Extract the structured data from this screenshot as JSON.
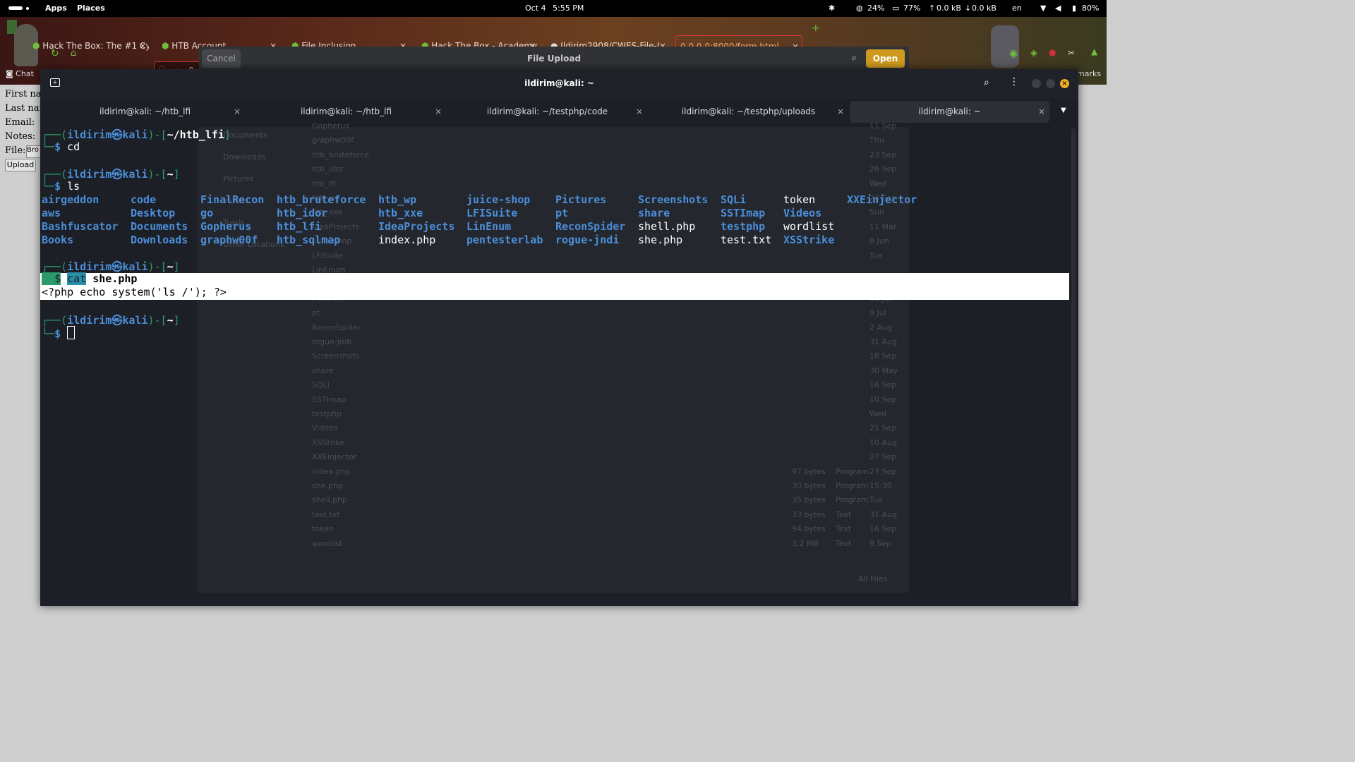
{
  "topbar": {
    "apps": "Apps",
    "places": "Places",
    "date": "Oct 4",
    "time": "5:55 PM",
    "cpu": "24%",
    "mem": "77%",
    "up": "0.0 kB",
    "down": "0.0 kB",
    "lang": "en",
    "battery": "80%"
  },
  "browser": {
    "tabs": [
      {
        "label": "Hack The Box: The #1 Cyb"
      },
      {
        "label": "HTB Account"
      },
      {
        "label": "File Inclusion"
      },
      {
        "label": "Hack The Box - Academy"
      },
      {
        "label": "Ildirim2908/CWES-File-I"
      },
      {
        "label": "0.0.0.0:8000/form.html"
      }
    ],
    "url_fragment": "0.",
    "bookmarks_label": "marks",
    "chat_label": "Chat"
  },
  "dialog": {
    "cancel": "Cancel",
    "title": "File Upload",
    "open": "Open",
    "sidebar": [
      "Documents",
      "Downloads",
      "Pictures",
      "Videos",
      "Trash",
      "Other Locations"
    ],
    "files": [
      {
        "name": "Gopherus",
        "size": "",
        "kind": "",
        "date": "11 Sep"
      },
      {
        "name": "graphw00f",
        "size": "",
        "kind": "",
        "date": "Thu"
      },
      {
        "name": "htb_bruteforce",
        "size": "",
        "kind": "",
        "date": "23 Sep"
      },
      {
        "name": "htb_idor",
        "size": "",
        "kind": "",
        "date": "26 Sep"
      },
      {
        "name": "htb_lfi",
        "size": "",
        "kind": "",
        "date": "Wed"
      },
      {
        "name": "htb_wp",
        "size": "",
        "kind": "",
        "date": "23 Sep"
      },
      {
        "name": "htb_xxe",
        "size": "",
        "kind": "",
        "date": "Sun"
      },
      {
        "name": "IdeaProjects",
        "size": "",
        "kind": "",
        "date": "11 Mar"
      },
      {
        "name": "juice-shop",
        "size": "",
        "kind": "",
        "date": "8 Jun"
      },
      {
        "name": "LFISuite",
        "size": "",
        "kind": "",
        "date": "Tue"
      },
      {
        "name": "LinEnum",
        "size": "",
        "kind": "",
        "date": ""
      },
      {
        "name": "pentesterlab",
        "size": "",
        "kind": "",
        "date": ""
      },
      {
        "name": "Pictures",
        "size": "",
        "kind": "",
        "date": "18 Jul"
      },
      {
        "name": "pt",
        "size": "",
        "kind": "",
        "date": "9 Jul"
      },
      {
        "name": "ReconSpider",
        "size": "",
        "kind": "",
        "date": "2 Aug"
      },
      {
        "name": "rogue-jndi",
        "size": "",
        "kind": "",
        "date": "31 Aug"
      },
      {
        "name": "Screenshots",
        "size": "",
        "kind": "",
        "date": "18 Sep"
      },
      {
        "name": "share",
        "size": "",
        "kind": "",
        "date": "30 May"
      },
      {
        "name": "SQLi",
        "size": "",
        "kind": "",
        "date": "16 Sep"
      },
      {
        "name": "SSTImap",
        "size": "",
        "kind": "",
        "date": "10 Sep"
      },
      {
        "name": "testphp",
        "size": "",
        "kind": "",
        "date": "Wed"
      },
      {
        "name": "Videos",
        "size": "",
        "kind": "",
        "date": "21 Sep"
      },
      {
        "name": "XSStrike",
        "size": "",
        "kind": "",
        "date": "10 Aug"
      },
      {
        "name": "XXEinjector",
        "size": "",
        "kind": "",
        "date": "27 Sep"
      },
      {
        "name": "index.php",
        "size": "97 bytes",
        "kind": "Program",
        "date": "27 Sep"
      },
      {
        "name": "she.php",
        "size": "30 bytes",
        "kind": "Program",
        "date": "15:30"
      },
      {
        "name": "shell.php",
        "size": "35 bytes",
        "kind": "Program",
        "date": "Tue"
      },
      {
        "name": "test.txt",
        "size": "33 bytes",
        "kind": "Text",
        "date": "31 Aug"
      },
      {
        "name": "token",
        "size": "94 bytes",
        "kind": "Text",
        "date": "16 Sep"
      },
      {
        "name": "wordlist",
        "size": "3.2 MB",
        "kind": "Text",
        "date": "9 Sep"
      }
    ],
    "filter": "All Files"
  },
  "webform": {
    "first": "First nar",
    "last": "Last nar",
    "email": "Email:",
    "notes": "Notes:",
    "file": "File:",
    "browse": "Bro",
    "upload": "Upload"
  },
  "terminal": {
    "title": "ildirim@kali: ~",
    "tabs": [
      {
        "label": "ildirim@kali: ~/htb_lfi"
      },
      {
        "label": "ildirim@kali: ~/htb_lfi"
      },
      {
        "label": "ildirim@kali: ~/testphp/code"
      },
      {
        "label": "ildirim@kali: ~/testphp/uploads"
      },
      {
        "label": "ildirim@kali: ~"
      }
    ],
    "user": "ildirim",
    "at": "㉿",
    "host": "kali",
    "dir1": "~/htb_lfi",
    "dir_home": "~",
    "cmd1": "cd",
    "cmd2": "ls",
    "cmd3a": "cat",
    "cmd3b": " she.php",
    "output": "<?php echo system('ls /'); ?>",
    "ls_columns": [
      [
        "airgeddon",
        "aws",
        "Bashfuscator",
        "Books"
      ],
      [
        "code",
        "Desktop",
        "Documents",
        "Downloads"
      ],
      [
        "FinalRecon",
        "go",
        "Gopherus",
        "graphw00f"
      ],
      [
        "htb_bruteforce",
        "htb_idor",
        "htb_lfi",
        "htb_sqlmap"
      ],
      [
        "htb_wp",
        "htb_xxe",
        "IdeaProjects",
        "index.php"
      ],
      [
        "juice-shop",
        "LFISuite",
        "LinEnum",
        "pentesterlab"
      ],
      [
        "Pictures",
        "pt",
        "ReconSpider",
        "rogue-jndi"
      ],
      [
        "Screenshots",
        "share",
        "shell.php",
        "she.php"
      ],
      [
        "SQLi",
        "SSTImap",
        "testphp",
        "test.txt"
      ],
      [
        "token",
        "Videos",
        "wordlist",
        "XSStrike"
      ],
      [
        "XXEinjector"
      ]
    ],
    "plain_files": [
      "index.php",
      "shell.php",
      "she.php",
      "test.txt",
      "token",
      "wordlist"
    ]
  }
}
